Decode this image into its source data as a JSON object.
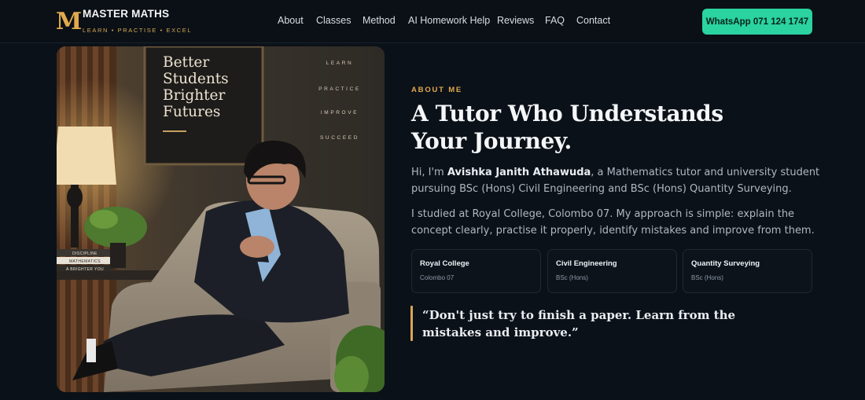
{
  "brand": {
    "logo_letter": "M",
    "name": "MASTER MATHS",
    "tagline": "LEARN • PRACTISE • EXCEL"
  },
  "nav": {
    "links": [
      "About",
      "Classes",
      "Method",
      "AI Homework Help",
      "Reviews",
      "FAQ",
      "Contact"
    ],
    "cta": "WhatsApp 071 124 1747"
  },
  "photo": {
    "frame_text": [
      "Better",
      "Students",
      "Brighter",
      "Futures"
    ],
    "wall_words": [
      "LEARN",
      "PRACTICE",
      "IMPROVE",
      "SUCCEED"
    ],
    "book_spines": [
      "DISCIPLINE",
      "MATHEMATICS",
      "A BRIGHTER YOU"
    ]
  },
  "about": {
    "eyebrow": "ABOUT ME",
    "heading": "A Tutor Who Understands Your Journey.",
    "intro_prefix": "Hi, I'm ",
    "intro_name": "Avishka Janith Athawuda",
    "intro_suffix": ", a Mathematics tutor and university student pursuing BSc (Hons) Civil Engineering and BSc (Hons) Quantity Surveying.",
    "approach": "I studied at Royal College, Colombo 07. My approach is simple: explain the concept clearly, practise it properly, identify mistakes and improve from them.",
    "cards": [
      {
        "title": "Royal College",
        "subtitle": "Colombo 07"
      },
      {
        "title": "Civil Engineering",
        "subtitle": "BSc (Hons)"
      },
      {
        "title": "Quantity Surveying",
        "subtitle": "BSc (Hons)"
      }
    ],
    "quote": "“Don't just try to finish a paper. Learn from the mistakes and improve.”"
  },
  "colors": {
    "accent_gold": "#e2a94f",
    "cta_green": "#2ad3a0",
    "background": "#0b1118"
  }
}
